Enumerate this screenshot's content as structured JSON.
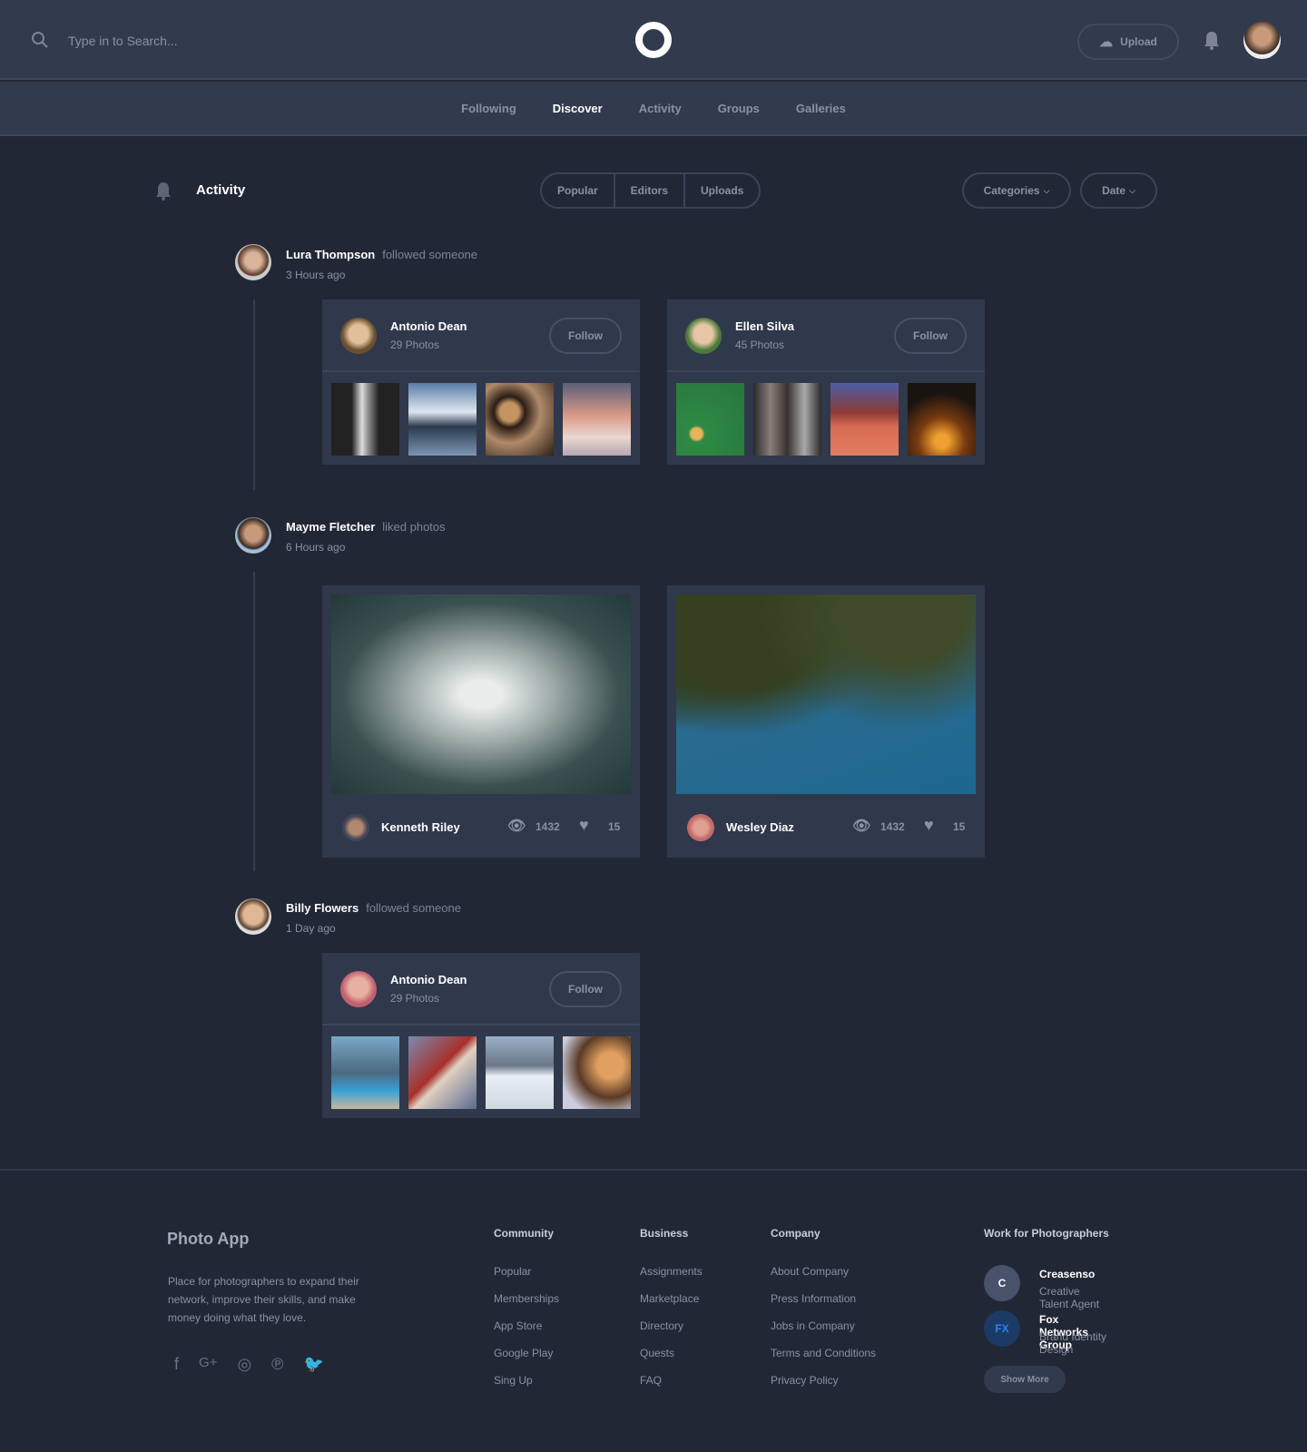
{
  "header": {
    "search_placeholder": "Type in to Search...",
    "upload_label": "Upload"
  },
  "nav": [
    "Following",
    "Discover",
    "Activity",
    "Groups",
    "Galleries"
  ],
  "toolbar": {
    "title": "Activity",
    "filters": [
      "Popular",
      "Editors",
      "Uploads"
    ],
    "categories_label": "Categories",
    "date_label": "Date"
  },
  "feed": [
    {
      "user": "Lura Thompson",
      "action": "followed someone",
      "time": "3 Hours ago",
      "cards": [
        {
          "name": "Antonio Dean",
          "photos": "29 Photos",
          "follow": "Follow"
        },
        {
          "name": "Ellen Silva",
          "photos": "45 Photos",
          "follow": "Follow"
        }
      ]
    },
    {
      "user": "Mayme Fletcher",
      "action": "liked photos",
      "time": "6 Hours ago",
      "photos": [
        {
          "author": "Kenneth Riley",
          "views": "1432",
          "likes": "15"
        },
        {
          "author": "Wesley Diaz",
          "views": "1432",
          "likes": "15"
        }
      ]
    },
    {
      "user": "Billy Flowers",
      "action": "followed someone",
      "time": "1 Day ago",
      "cards": [
        {
          "name": "Antonio Dean",
          "photos": "29 Photos",
          "follow": "Follow"
        }
      ]
    }
  ],
  "footer": {
    "brand": "Photo App",
    "description": "Place for photographers to expand their network, improve their skills, and make money doing what they love.",
    "columns": [
      {
        "title": "Community",
        "links": [
          "Popular",
          "Memberships",
          "App Store",
          "Google Play",
          "Sing Up"
        ]
      },
      {
        "title": "Business",
        "links": [
          "Assignments",
          "Marketplace",
          "Directory",
          "Quests",
          "FAQ"
        ]
      },
      {
        "title": "Company",
        "links": [
          "About Company",
          "Press Information",
          "Jobs in Company",
          "Terms and Conditions",
          "Privacy Policy"
        ]
      }
    ],
    "work": {
      "title": "Work for Photographers",
      "items": [
        {
          "initials": "C",
          "name": "Creasenso",
          "role": "Creative Talent Agent"
        },
        {
          "initials": "FX",
          "name": "Fox Networks Group",
          "role": "Brand Identity Design"
        }
      ],
      "show_more": "Show More"
    }
  }
}
